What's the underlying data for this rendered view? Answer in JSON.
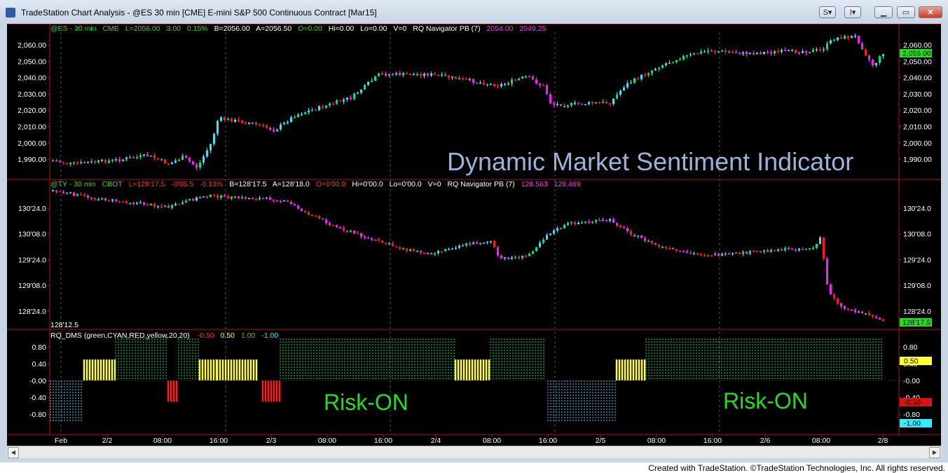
{
  "window": {
    "title": "TradeStation Chart Analysis - @ES 30 min [CME] E-mini S&P 500 Continuous Contract [Mar15]",
    "buttons": {
      "s_label": "S",
      "i_label": "I"
    }
  },
  "panel1": {
    "symbol": "@ES - 30 min",
    "exchange": "CME",
    "last": "L=2056.00",
    "chg": "3.00",
    "pct": "0.15%",
    "bid": "B=2056.00",
    "ask": "A=2056.50",
    "open": "O=0.00",
    "hi": "Hi=0.00",
    "lo": "Lo=0.00",
    "vol": "V=0",
    "indicator": "RQ Navigator PB (7)",
    "ind_v1": "2054.00",
    "ind_v2": "2049.25",
    "price_label": "2,056.00",
    "ticks": [
      "2,060.00",
      "2,050.00",
      "2,040.00",
      "2,030.00",
      "2,020.00",
      "2,010.00",
      "2,000.00",
      "1,990.00"
    ],
    "overlay_text": "Dynamic Market Sentiment Indicator"
  },
  "panel2": {
    "symbol": "@TY - 30 min",
    "exchange": "CBOT",
    "last": "L=128'17.5",
    "chg": "-0'05.5",
    "pct": "-0.13%",
    "bid": "B=128'17.5",
    "ask": "A=128'18.0",
    "open": "O=0'00.0",
    "hi": "Hi=0'00.0",
    "lo": "Lo=0'00.0",
    "vol": "V=0",
    "indicator": "RQ Navigator PB (7)",
    "ind_v1": "128.563",
    "ind_v2": "128.469",
    "price_label": "128'17.5",
    "bottom_left_label": "128'12.5",
    "ticks": [
      "130'24.0",
      "130'08.0",
      "129'24.0",
      "129'08.0",
      "128'24.0"
    ]
  },
  "panel3": {
    "indicator_name": "RQ_DMS (green,CYAN,RED,yellow,20,20)",
    "v_red": "-0.50",
    "v_yellow": "0.50",
    "v_green": "1.00",
    "v_cyan": "-1.00",
    "ticks": [
      "0.80",
      "0.40",
      "-0.00",
      "-0.40",
      "-0.80"
    ],
    "tag_yellow": "0.50",
    "tag_red": "-0.50",
    "tag_cyan": "-1.00",
    "risk_on_1": "Risk-ON",
    "risk_on_2": "Risk-ON"
  },
  "xaxis": {
    "labels": [
      "Feb",
      "2/2",
      "08:00",
      "16:00",
      "2/3",
      "08:00",
      "16:00",
      "2/4",
      "08:00",
      "16:00",
      "2/5",
      "08:00",
      "16:00",
      "2/6",
      "08:00",
      "2/8"
    ]
  },
  "colors": {
    "up": "#00e676",
    "up_cyan": "#40e0ff",
    "down": "#ff1a1a",
    "down_magenta": "#ff1aff",
    "yellow": "#ffff33",
    "green_text": "#22dd22",
    "magenta_text": "#ff33ff",
    "overlay": "#9bb3d9",
    "panel_border": "#b01515"
  },
  "footer": "Created with TradeStation. ©TradeStation Technologies, Inc. All rights reserved."
}
